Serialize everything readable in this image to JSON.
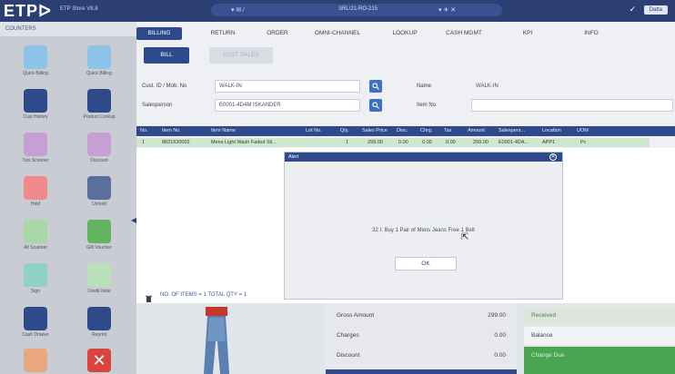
{
  "app": {
    "logo": "ETPᐅ",
    "name": "ETP Store V8.8",
    "center_left": "▾ ✉ ⁄",
    "center_mid": "SRL/21-RO-215",
    "center_right": "▾ ✈ ✕",
    "user_label": "Datta",
    "top_right_check": "✓"
  },
  "left": {
    "header": "COUNTERS",
    "collapse_glyph": "◀",
    "tiles": [
      {
        "label": "Quick Billing",
        "color": "#8ec3ea"
      },
      {
        "label": "Quick Billing",
        "color": "#8ec3ea"
      },
      {
        "label": "Cust History",
        "color": "#2f4a8a"
      },
      {
        "label": "Product Lookup",
        "color": "#2f4a8a"
      },
      {
        "label": "Tots Scanner",
        "color": "#c7a0d3"
      },
      {
        "label": "Discount",
        "color": "#c7a0d3"
      },
      {
        "label": "Hold",
        "color": "#f08a8a"
      },
      {
        "label": "Unhold",
        "color": "#5b6f9c"
      },
      {
        "label": "Alt Scanner",
        "color": "#a9d8a6"
      },
      {
        "label": "Gift Voucher",
        "color": "#62b45f"
      },
      {
        "label": "Sign",
        "color": "#8fd0c7"
      },
      {
        "label": "Credit Note",
        "color": "#b9e0b7"
      },
      {
        "label": "Cash Drawer",
        "color": "#2f4a8a"
      },
      {
        "label": "Reprint",
        "color": "#2f4a8a"
      },
      {
        "label": "",
        "color": "#e9a780"
      },
      {
        "label": "",
        "color": "#d9443f"
      }
    ]
  },
  "tabs": [
    {
      "label": "BILLING",
      "active": true
    },
    {
      "label": "RETURN",
      "active": false
    },
    {
      "label": "ORDER",
      "active": false
    },
    {
      "label": "OMNI-CHANNEL",
      "active": false
    },
    {
      "label": "LOOKUP",
      "active": false
    },
    {
      "label": "CASH MGMT",
      "active": false
    },
    {
      "label": "KPI",
      "active": false
    },
    {
      "label": "INFO",
      "active": false
    }
  ],
  "subtabs": {
    "bill": "BILL",
    "other": "LOST SALES"
  },
  "form": {
    "cust_label": "Cust. ID / Mob. No",
    "cust_value": "WALK-IN",
    "sales_label": "Salesperson",
    "sales_value": "E0001-4D4M ISKANDER",
    "name_label": "Name",
    "name_value": "WALK-IN",
    "item_label": "Item No."
  },
  "table": {
    "headers": [
      "No.",
      "Item No.",
      "Item Name",
      "Lot No.",
      "Qty.",
      "Sales Price",
      "Disc.",
      "Chrg.",
      "Tax",
      "Amount",
      "Salespers...",
      "Location",
      "UOM"
    ],
    "row": [
      "1",
      "8821630002",
      "Mens Light Wash Faded Sli...",
      "",
      "1",
      "299.00",
      "0.00",
      "0.00",
      "0.00",
      "299.00",
      "E0001-4DA...",
      "APP1",
      "Pc"
    ]
  },
  "alert": {
    "title": "Alert",
    "close": "✕",
    "message": "32 I: Buy 1 Pair of Mens Jeans Free 1 Belt",
    "ok_label": "OK"
  },
  "footer": {
    "count_text": "NO. OF ITEMS = 1   TOTAL QTY = 1"
  },
  "summary": {
    "gross_label": "Gross Amount",
    "gross_value": "299.00",
    "charges_label": "Charges",
    "charges_value": "0.00",
    "discount_label": "Discount",
    "discount_value": "0.00"
  },
  "payment": {
    "received_label": "Received",
    "balance_label": "Balance",
    "change_label": "Change Due"
  },
  "colors": {
    "brand": "#2b3f73",
    "accent": "#2f4a8a",
    "row_green": "#cfe7cf",
    "change_green": "#4aa552"
  }
}
